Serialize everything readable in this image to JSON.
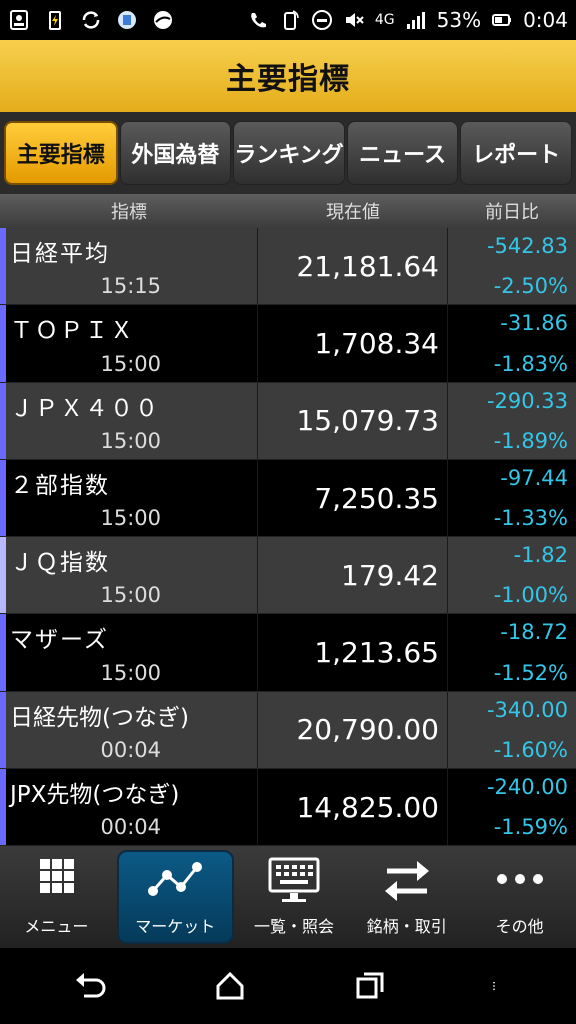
{
  "statusbar": {
    "battery_percent": "53%",
    "time": "0:04",
    "network": "4G"
  },
  "header": {
    "title": "主要指標"
  },
  "tabs": [
    {
      "label": "主要指標",
      "active": true
    },
    {
      "label": "外国為替",
      "active": false
    },
    {
      "label": "ランキング",
      "active": false
    },
    {
      "label": "ニュース",
      "active": false
    },
    {
      "label": "レポート",
      "active": false
    }
  ],
  "columns": {
    "index": "指標",
    "price": "現在値",
    "change": "前日比"
  },
  "rows": [
    {
      "name": "日経平均",
      "time": "15:15",
      "price": "21,181.64",
      "change": "-542.83",
      "percent": "-2.50%"
    },
    {
      "name": "ＴＯＰＩＸ",
      "time": "15:00",
      "price": "1,708.34",
      "change": "-31.86",
      "percent": "-1.83%"
    },
    {
      "name": "ＪＰＸ４００",
      "time": "15:00",
      "price": "15,079.73",
      "change": "-290.33",
      "percent": "-1.89%"
    },
    {
      "name": "２部指数",
      "time": "15:00",
      "price": "7,250.35",
      "change": "-97.44",
      "percent": "-1.33%"
    },
    {
      "name": "ＪＱ指数",
      "time": "15:00",
      "price": "179.42",
      "change": "-1.82",
      "percent": "-1.00%"
    },
    {
      "name": "マザーズ",
      "time": "15:00",
      "price": "1,213.65",
      "change": "-18.72",
      "percent": "-1.52%"
    },
    {
      "name": "日経先物(つなぎ)",
      "time": "00:04",
      "price": "20,790.00",
      "change": "-340.00",
      "percent": "-1.60%"
    },
    {
      "name": "JPX先物(つなぎ)",
      "time": "00:04",
      "price": "14,825.00",
      "change": "-240.00",
      "percent": "-1.59%"
    }
  ],
  "bottomnav": [
    {
      "label": "メニュー",
      "icon": "grid-icon",
      "active": false
    },
    {
      "label": "マーケット",
      "icon": "chart-line-icon",
      "active": true
    },
    {
      "label": "一覧・照会",
      "icon": "keyboard-monitor-icon",
      "active": false
    },
    {
      "label": "銘柄・取引",
      "icon": "swap-arrows-icon",
      "active": false
    },
    {
      "label": "その他",
      "icon": "more-dots-icon",
      "active": false
    }
  ],
  "colors": {
    "accent": "#f2c232",
    "change_text": "#34c6e8",
    "row_marker": "#6a6aff"
  }
}
